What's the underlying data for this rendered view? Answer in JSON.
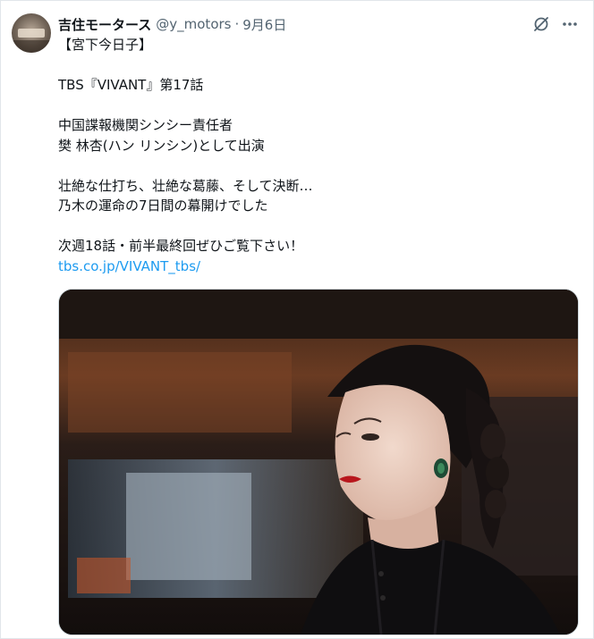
{
  "tweet": {
    "display_name": "吉住モータース",
    "handle": "@y_motors",
    "separator": "·",
    "date": "9月6日",
    "lines": [
      "【宮下今日子】",
      "",
      "TBS『VIVANT』第17話",
      "",
      "中国諜報機関シンシー責任者",
      "樊 林杏(ハン リンシン)として出演",
      "",
      "壮絶な仕打ち、壮絶な葛藤、そして決断…",
      "乃木の運命の7日間の幕開けでした",
      "",
      "次週18話・前半最終回ぜひご覧下さい！"
    ],
    "link_text": "tbs.co.jp/VIVANT_tbs/"
  },
  "icons": {
    "grok": "grok-icon",
    "more": "more-icon",
    "avatar": "avatar"
  },
  "colors": {
    "text": "#0f1419",
    "secondary": "#536471",
    "link": "#1d9bf0",
    "border": "#cfd9de"
  }
}
